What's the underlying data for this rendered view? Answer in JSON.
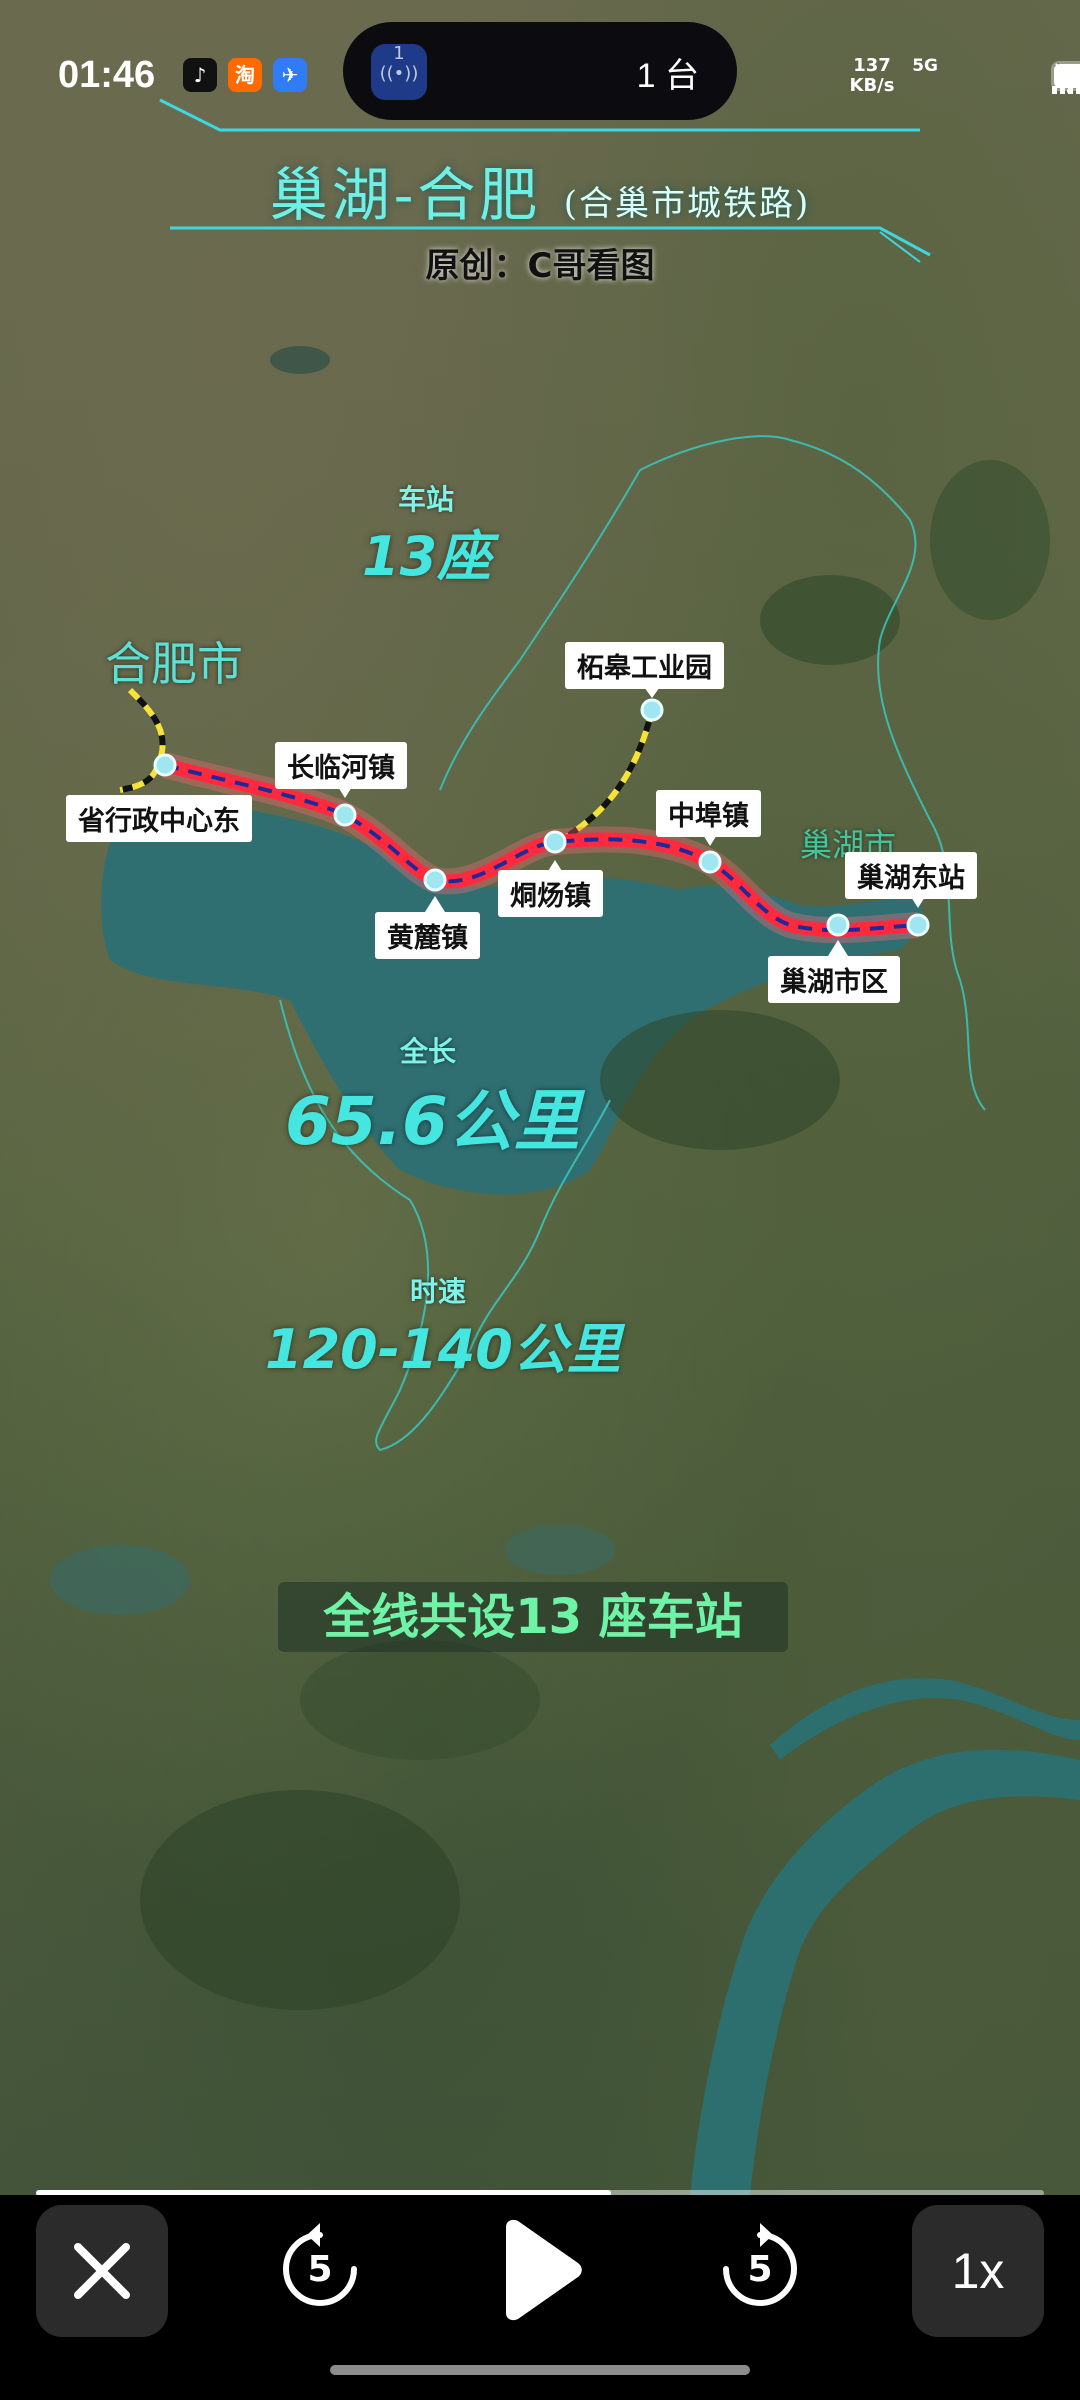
{
  "status_bar": {
    "time": "01:46",
    "app_icons": [
      "tiktok-icon",
      "taobao-icon",
      "bird-app-icon"
    ],
    "island_badge": "1",
    "island_text": "1 台",
    "net_speed_value": "137",
    "net_speed_unit": "KB/s",
    "network": "5G"
  },
  "map": {
    "title": "巢湖-合肥",
    "subtitle": "(合巢市城铁路)",
    "author": "原创：C哥看图",
    "stations_caption": "车站",
    "stations_value": "13座",
    "city_hefei": "合肥市",
    "city_chaohu": "巢湖市",
    "length_caption": "全长",
    "length_value": "65.6公里",
    "speed_caption": "时速",
    "speed_value": "120-140公里",
    "bottom_caption": "全线共设13 座车站",
    "stations": [
      "省行政中心东",
      "长临河镇",
      "黄麓镇",
      "烔炀镇",
      "柘皋工业园",
      "中埠镇",
      "巢湖市区",
      "巢湖东站"
    ]
  },
  "player": {
    "progress": 0.57,
    "close_icon": "close-icon",
    "rewind_label": "5",
    "forward_label": "5",
    "play_icon": "play-icon",
    "speed_label": "1x"
  },
  "colors": {
    "route_red": "#ff2a3d",
    "route_blue": "#1c2a9a",
    "station_cyan": "#8fe6f0",
    "title_cyan": "#6ff0e6",
    "caption_green": "#6ff3a6",
    "branch_yellow": "#f5e23a"
  }
}
